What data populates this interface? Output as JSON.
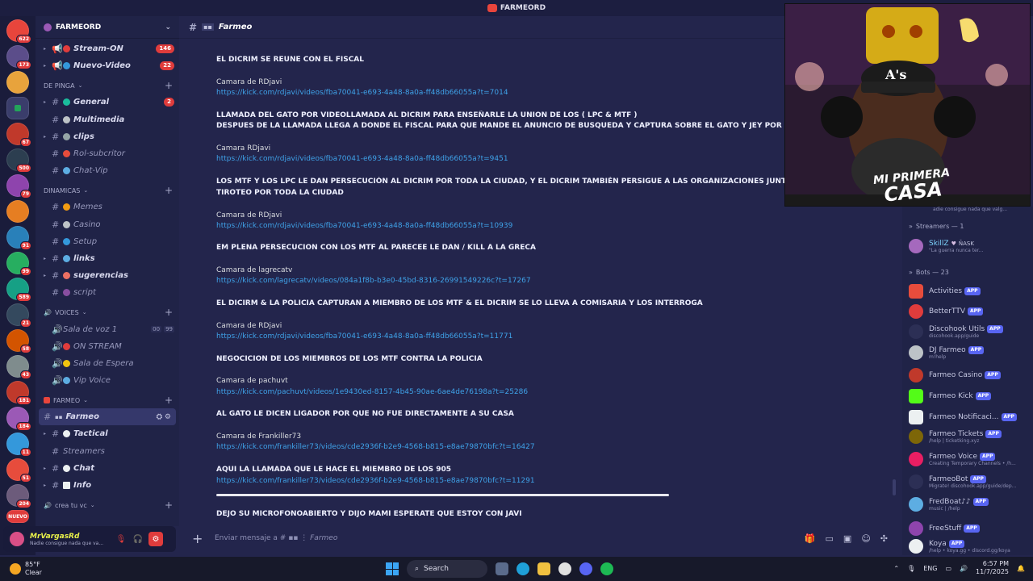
{
  "window": {
    "title": "FARMEORD"
  },
  "server_rail": {
    "badges": [
      "622",
      "173",
      "67",
      "500",
      "79",
      "91",
      "99",
      "589",
      "21",
      "58",
      "43",
      "780",
      "181",
      "184",
      "11",
      "51",
      "204"
    ],
    "pill_label": "NUEVO"
  },
  "sidebar": {
    "server_name": "FARMEORD",
    "top_channels": [
      {
        "name": "Stream-ON",
        "count": "146"
      },
      {
        "name": "Nuevo-Video",
        "count": "22"
      }
    ],
    "categories": [
      {
        "name": "DE PINGA",
        "channels": [
          {
            "name": "General",
            "count": "2"
          },
          {
            "name": "Multimedia"
          },
          {
            "name": "clips"
          },
          {
            "name": "Rol-subcritor"
          },
          {
            "name": "Chat-Vip"
          }
        ]
      },
      {
        "name": "DINAMICAS",
        "channels": [
          {
            "name": "Memes"
          },
          {
            "name": "Casino"
          },
          {
            "name": "Setup"
          },
          {
            "name": "links"
          },
          {
            "name": "sugerencias"
          },
          {
            "name": "script"
          }
        ]
      },
      {
        "name": "VOICES",
        "channels": [
          {
            "name": "Sala de voz 1",
            "n1": "00",
            "n2": "99"
          },
          {
            "name": "ON STREAM"
          },
          {
            "name": "Sala de Espera"
          },
          {
            "name": "Vip Voice"
          }
        ]
      },
      {
        "name": "FARMEO",
        "channels": [
          {
            "name": "Farmeo"
          },
          {
            "name": "Tactical"
          },
          {
            "name": "Streamers"
          },
          {
            "name": "Chat"
          },
          {
            "name": "Info"
          }
        ]
      },
      {
        "name": "crea tu vc"
      }
    ]
  },
  "user_panel": {
    "username": "MrVargasRd",
    "status": "Nadie consigue nada que va..."
  },
  "channel_header": {
    "name": "Farmeo",
    "tag": "▪▪"
  },
  "messages": [
    {
      "text": "EL DICRIM SE REUNE CON EL FISCAL",
      "heading": true
    },
    {
      "text": "Camara de RDjavi"
    },
    {
      "text": "https://kick.com/rdjavi/videos/fba70041-e693-4a48-8a0a-ff48db66055a?t=7014",
      "link": true
    },
    {
      "text": "LLAMADA DEL GATO POR VIDEOLLAMADA AL DICRIM PARA ENSEÑARLE LA UNION DE LOS ( LPC & MTF )",
      "heading": true
    },
    {
      "text": "DESPUES DE LA LLAMADA LLEGA A DONDE EL FISCAL PARA QUE MANDE EL ANUNCIO DE BUSQUEDA Y CAPTURA SOBRE EL GATO Y JEY POR 5M DE DO",
      "heading": true
    },
    {
      "text": "Camara RDjavi"
    },
    {
      "text": "https://kick.com/rdjavi/videos/fba70041-e693-4a48-8a0a-ff48db66055a?t=9451",
      "link": true
    },
    {
      "text": "LOS MTF Y LOS LPC LE DAN PERSECUCIÓN AL DICRIM POR TODA LA CIUDAD, Y EL DICRIM TAMBIÉN PERSIGUE A LAS ORGANIZACIONES JUNTO CON LA",
      "heading": true
    },
    {
      "text": "TIROTEO POR TODA LA CIUDAD",
      "heading": true
    },
    {
      "text": "Camara de RDjavi"
    },
    {
      "text": "https://kick.com/rdjavi/videos/fba70041-e693-4a48-8a0a-ff48db66055a?t=10939",
      "link": true
    },
    {
      "text": "EM PLENA PERSECUCION CON LOS MTF AL PARECEE LE DAN / KILL A LA GRECA",
      "heading": true
    },
    {
      "text": "Camara de lagrecatv"
    },
    {
      "text": "https://kick.com/lagrecatv/videos/084a1f8b-b3e0-45bd-8316-26991549226c?t=17267",
      "link": true
    },
    {
      "text": "EL DICIRM & LA POLICIA CAPTURAN A MIEMBRO DE LOS MTF & EL DICRIM SE LO LLEVA A COMISARIA Y LOS INTERROGA",
      "heading": true
    },
    {
      "text": "Camara de RDjavi"
    },
    {
      "text": "https://kick.com/rdjavi/videos/fba70041-e693-4a48-8a0a-ff48db66055a?t=11771",
      "link": true
    },
    {
      "text": "NEGOCICION DE LOS MIEMBROS DE LOS MTF CONTRA LA POLICIA",
      "heading": true
    },
    {
      "text": "Camara de pachuvt"
    },
    {
      "text": "https://kick.com/pachuvt/videos/1e9430ed-8157-4b45-90ae-6ae4de76198a?t=25286",
      "link": true
    },
    {
      "text": "AL GATO LE DICEN LIGADOR POR QUE NO FUE DIRECTAMENTE A SU CASA",
      "heading": true
    },
    {
      "text": "Camara de Frankiller73"
    },
    {
      "text": "https://kick.com/frankiller73/videos/cde2936f-b2e9-4568-b815-e8ae79870bfc?t=16427",
      "link": true
    },
    {
      "text": "AQUI LA LLAMADA QUE LE HACE EL MIEMBRO DE LOS 905",
      "heading": true
    },
    {
      "text": "https://kick.com/frankiller73/videos/cde2936f-b2e9-4568-b815-e8ae79870bfc?t=11291",
      "link": true
    },
    {
      "text": "DEJO SU MICROFONOABIERTO Y DIJO MAMI ESPERATE QUE ESTOY CON JAVI",
      "heading": true
    }
  ],
  "composer": {
    "placeholder": "Enviar mensaje a #",
    "channel": "Farmeo"
  },
  "webcam": {
    "sign_line1": "MI PRIMERA",
    "sign_line2": "CASA",
    "cap_text": "A's"
  },
  "members": {
    "streamers_header": "Streamers — 1",
    "streamer": {
      "name": "SkillZ",
      "tag": "ÑASK",
      "status": "\"La guerra nunca ter..."
    },
    "status_above": "adie consigue nada que valg...",
    "bots_header": "Bots — 23",
    "app_label": "APP",
    "bots": [
      {
        "name": "Activities",
        "sub": ""
      },
      {
        "name": "BetterTTV",
        "sub": ""
      },
      {
        "name": "Discohook Utils",
        "sub": "discohook.app/guide"
      },
      {
        "name": "DJ Farmeo",
        "sub": "m!help"
      },
      {
        "name": "Farmeo Casino",
        "sub": ""
      },
      {
        "name": "Farmeo Kick",
        "sub": ""
      },
      {
        "name": "Farmeo Notificaci...",
        "sub": ""
      },
      {
        "name": "Farmeo Tickets",
        "sub": "/help | ticketking.xyz"
      },
      {
        "name": "Farmeo Voice",
        "sub": "Creating Temporary Channels • /h..."
      },
      {
        "name": "FarmeoBot",
        "sub": "Migrate! discohook.app/guide/dep..."
      },
      {
        "name": "FredBoat♪♪",
        "sub": "music | /help"
      },
      {
        "name": "FreeStuff",
        "sub": ""
      },
      {
        "name": "Koya",
        "sub": "/help • koya.gg • discord.gg/koya"
      }
    ]
  },
  "taskbar": {
    "temp": "85°F",
    "weather": "Clear",
    "search": "Search",
    "lang": "ENG",
    "time": "6:57 PM",
    "date": "11/7/2025"
  },
  "colors": {
    "bg": "#23254c",
    "accent": "#e03c3c",
    "link": "#3fa2e8",
    "app_badge": "#5865f2"
  }
}
